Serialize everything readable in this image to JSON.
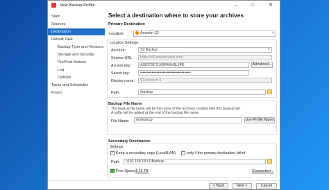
{
  "window": {
    "title": "New Backup Profile"
  },
  "sidebar": {
    "items": [
      {
        "label": "Start"
      },
      {
        "label": "Sources"
      },
      {
        "label": "Destination"
      },
      {
        "label": "Default Task"
      },
      {
        "label": "Backup Type and Versions"
      },
      {
        "label": "Storage and Security"
      },
      {
        "label": "Pre/Post Actions"
      },
      {
        "label": "Log"
      },
      {
        "label": "Options"
      },
      {
        "label": "Tasks and Schedules"
      },
      {
        "label": "Finish"
      }
    ]
  },
  "main": {
    "heading": "Select a destination where to store your archives",
    "primary": {
      "section_title": "Primary Destination",
      "location_label": "Location:",
      "location_value": "Amazon S3",
      "settings_title": "Location Settings",
      "account_label": "Account:",
      "account_value": "S3 Backup",
      "service_url_label": "Service URL:",
      "service_url_value": "https://s3.amazonaws.com",
      "access_key_label": "Access key:",
      "access_key_value": "ASIGTSF7LK5R4XH3LJPK",
      "advanced_label": "Advanced...",
      "secret_key_label": "Secret key:",
      "secret_key_value": "••••••••••••••••••••••••••••••••••••••••",
      "display_name_label": "Display name:",
      "display_name_value": "S3 Account 1",
      "path_label": "Path:",
      "path_value": "/backup"
    },
    "filename": {
      "section_title": "Backup File Name",
      "hint_line1": "The backup file name will be the name of the archives created with this backup set.",
      "hint_line2": "A suffix will be added at the end of the backup file name.",
      "label": "File Name:",
      "value": "mybackup",
      "use_profile_label": "Use Profile Name"
    },
    "secondary": {
      "section_title": "Secondary Destination",
      "settings_title": "Settings",
      "keep_copy_label": "Keep a secondary copy (Local/LAN)",
      "only_if_failed_label": "only if the primary destination failed",
      "path_label": "Path:",
      "path_value": "\\\\192.168.150.1\\Backup",
      "free_space_label": "Free Space:",
      "free_space_value": "1.15 TB",
      "connection_label": "Connection..."
    }
  },
  "footer": {
    "back_label": "< Back",
    "next_label": "Next >",
    "cancel_label": "Cancel"
  }
}
